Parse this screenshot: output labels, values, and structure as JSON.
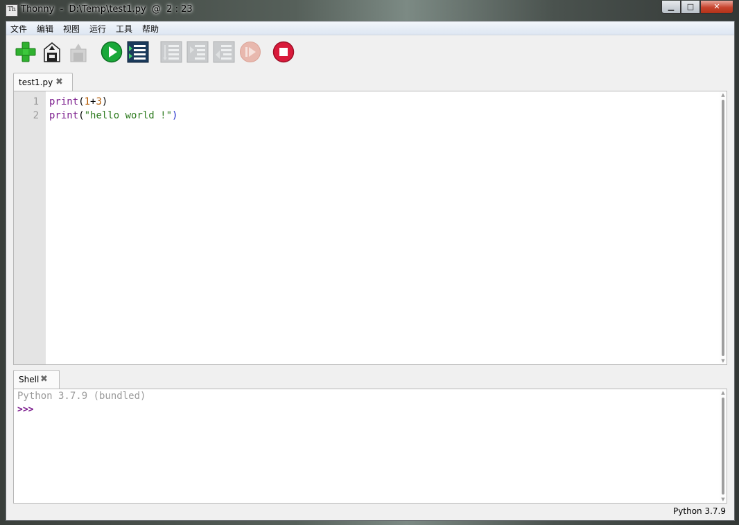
{
  "window": {
    "title": "Thonny  -  D:\\Temp\\test1.py  @  2 : 23",
    "app_icon_glyph": "Th",
    "buttons": {
      "minimize": "▁",
      "maximize": "□",
      "close": "✕"
    }
  },
  "menu": [
    "文件",
    "编辑",
    "视图",
    "运行",
    "工具",
    "帮助"
  ],
  "toolbar": {
    "icons": [
      {
        "name": "new-file-icon",
        "enabled": true,
        "color": "#2fb12f"
      },
      {
        "name": "save-icon",
        "enabled": true,
        "color": "#222222"
      },
      {
        "name": "save-disabled-icon",
        "enabled": false,
        "color": "#b5b5b5"
      },
      {
        "name": "run-icon",
        "enabled": true,
        "color": "#19a839"
      },
      {
        "name": "debug-icon",
        "enabled": true,
        "color": "#1b3a5c"
      },
      {
        "name": "step-over-icon",
        "enabled": false,
        "color": "#b5b5b5"
      },
      {
        "name": "step-into-icon",
        "enabled": false,
        "color": "#b5b5b5"
      },
      {
        "name": "step-out-icon",
        "enabled": false,
        "color": "#b5b5b5"
      },
      {
        "name": "resume-icon",
        "enabled": false,
        "color": "#e8b8ae"
      },
      {
        "name": "stop-icon",
        "enabled": true,
        "color": "#d91a3b"
      }
    ]
  },
  "editor": {
    "tab_label": "test1.py",
    "tab_close": "✖",
    "line_numbers": [
      "1",
      "2"
    ],
    "lines": [
      {
        "fn": "print",
        "open": "(",
        "a": "1",
        "op": "+",
        "b": "3",
        "close": ")"
      },
      {
        "fn": "print",
        "open": "(",
        "str": "\"hello world !\"",
        "close": ")"
      }
    ]
  },
  "shell": {
    "tab_label": "Shell",
    "tab_close": "✖",
    "banner": "Python 3.7.9 (bundled)",
    "prompt": ">>>"
  },
  "status": {
    "interpreter": "Python 3.7.9"
  }
}
